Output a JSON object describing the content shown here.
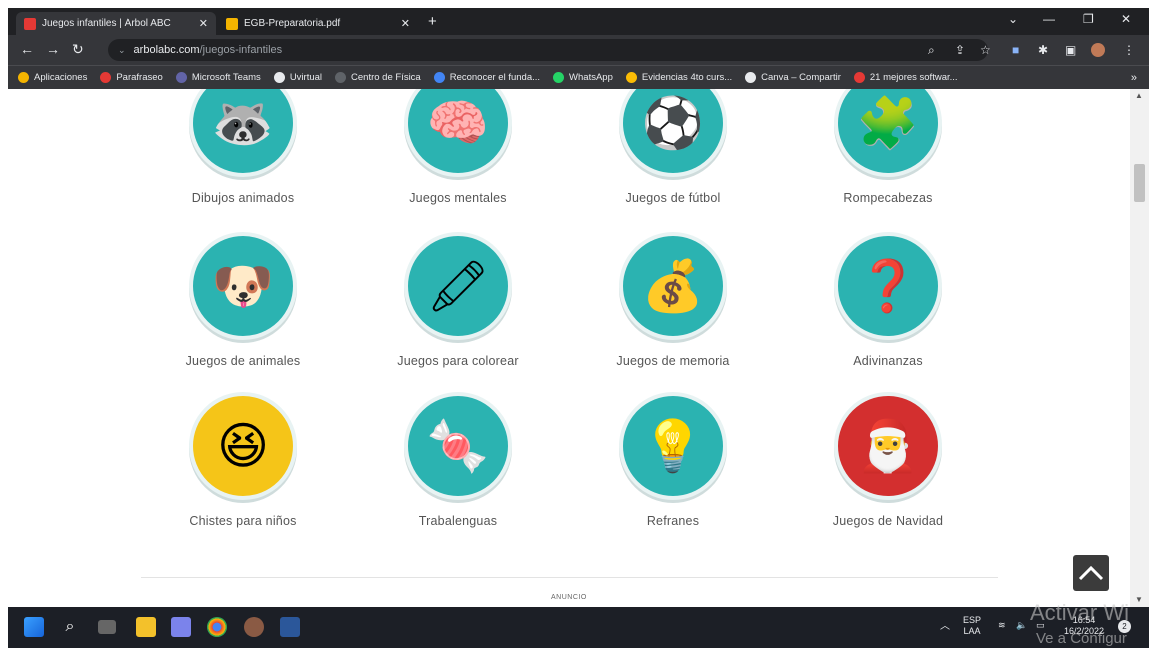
{
  "tabs": [
    {
      "title": "Juegos infantiles | Árbol ABC",
      "active": true,
      "favicon_color": "#e53935"
    },
    {
      "title": "EGB-Preparatoria.pdf",
      "active": false,
      "favicon_color": "#f4b400"
    }
  ],
  "address": {
    "host": "arbolabc.com",
    "path": "/juegos-infantiles"
  },
  "bookmarks": [
    {
      "label": "Aplicaciones",
      "color": "#f4b400"
    },
    {
      "label": "Parafraseo",
      "color": "#e53935"
    },
    {
      "label": "Microsoft Teams",
      "color": "#6264a7"
    },
    {
      "label": "Uvirtual",
      "color": "#e8eaed"
    },
    {
      "label": "Centro de Física",
      "color": "#5f6368"
    },
    {
      "label": "Reconocer el funda...",
      "color": "#4285f4"
    },
    {
      "label": "WhatsApp",
      "color": "#25d366"
    },
    {
      "label": "Evidencias 4to curs...",
      "color": "#fbbc05"
    },
    {
      "label": "Canva – Compartir",
      "color": "#e8eaed"
    },
    {
      "label": "21 mejores softwar...",
      "color": "#e53935"
    }
  ],
  "categories": [
    {
      "label": "Dibujos animados",
      "icon": "raccoon-icon",
      "bg": "#2bb3b1",
      "glyph": "🦝"
    },
    {
      "label": "Juegos mentales",
      "icon": "brain-icon",
      "bg": "#2bb3b1",
      "glyph": "🧠"
    },
    {
      "label": "Juegos de fútbol",
      "icon": "soccer-ball-icon",
      "bg": "#2bb3b1",
      "glyph": "⚽"
    },
    {
      "label": "Rompecabezas",
      "icon": "puzzle-icon",
      "bg": "#2bb3b1",
      "glyph": "🧩"
    },
    {
      "label": "Juegos de animales",
      "icon": "tablet-animals-icon",
      "bg": "#2bb3b1",
      "glyph": "🐶"
    },
    {
      "label": "Juegos para colorear",
      "icon": "crayons-icon",
      "bg": "#2bb3b1",
      "glyph": "🖍"
    },
    {
      "label": "Juegos de memoria",
      "icon": "treasure-icon",
      "bg": "#2bb3b1",
      "glyph": "💰"
    },
    {
      "label": "Adivinanzas",
      "icon": "question-box-icon",
      "bg": "#2bb3b1",
      "glyph": "❓"
    },
    {
      "label": "Chistes para niños",
      "icon": "laughing-face-icon",
      "bg": "#f5c518",
      "glyph": "😆"
    },
    {
      "label": "Trabalenguas",
      "icon": "candy-icon",
      "bg": "#2bb3b1",
      "glyph": "🍬"
    },
    {
      "label": "Refranes",
      "icon": "boy-idea-icon",
      "bg": "#2bb3b1",
      "glyph": "💡"
    },
    {
      "label": "Juegos de Navidad",
      "icon": "santa-icon",
      "bg": "#d32f2f",
      "glyph": "🎅"
    }
  ],
  "ad_label": "ANUNCIO",
  "taskbar": {
    "lang": "ESP",
    "region": "LAA",
    "time": "16:54",
    "date": "16/2/2022",
    "notifications": "2"
  },
  "watermark": {
    "line1": "Activar Wi",
    "line2": "Ve a Configur"
  }
}
